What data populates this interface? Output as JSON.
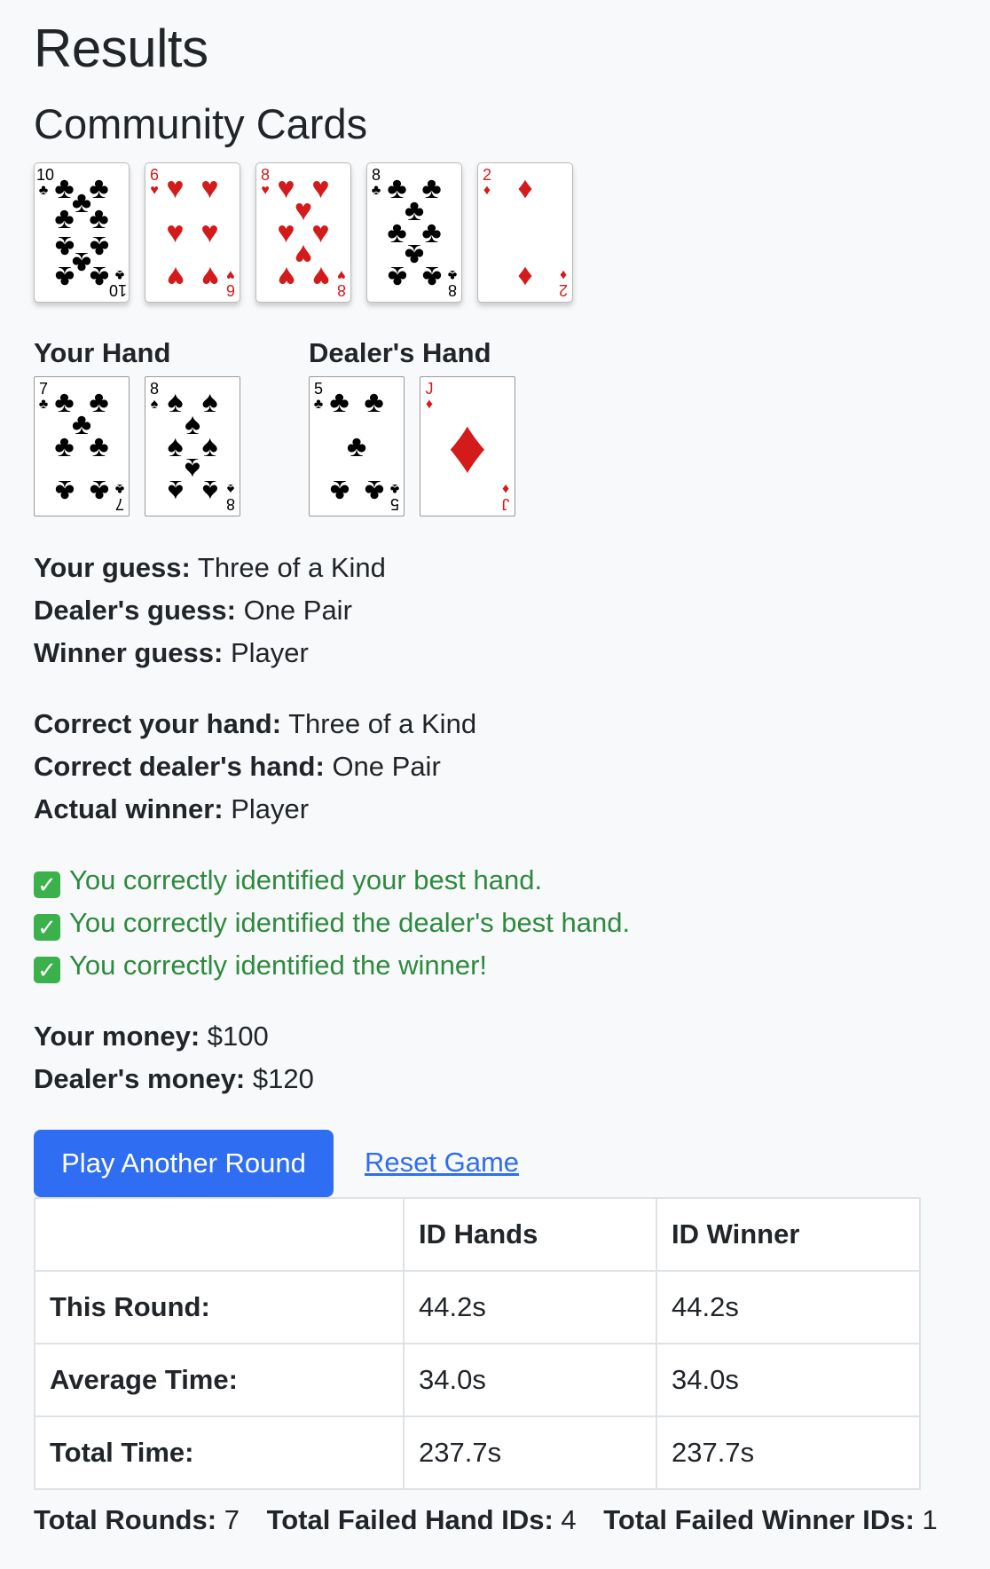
{
  "page_title": "Results",
  "community": {
    "heading": "Community Cards",
    "cards": [
      {
        "rank": "10",
        "suit": "♣",
        "color": "black"
      },
      {
        "rank": "6",
        "suit": "♥",
        "color": "red"
      },
      {
        "rank": "8",
        "suit": "♥",
        "color": "red"
      },
      {
        "rank": "8",
        "suit": "♣",
        "color": "black"
      },
      {
        "rank": "2",
        "suit": "♦",
        "color": "red"
      }
    ]
  },
  "your_hand": {
    "label": "Your Hand",
    "cards": [
      {
        "rank": "7",
        "suit": "♣",
        "color": "black"
      },
      {
        "rank": "8",
        "suit": "♠",
        "color": "black"
      }
    ]
  },
  "dealer_hand": {
    "label": "Dealer's Hand",
    "cards": [
      {
        "rank": "5",
        "suit": "♣",
        "color": "black"
      },
      {
        "rank": "J",
        "suit": "♦",
        "color": "red"
      }
    ]
  },
  "guesses": {
    "your_label": "Your guess:",
    "your_value": "Three of a Kind",
    "dealer_label": "Dealer's guess:",
    "dealer_value": "One Pair",
    "winner_label": "Winner guess:",
    "winner_value": "Player"
  },
  "correct": {
    "your_label": "Correct your hand:",
    "your_value": "Three of a Kind",
    "dealer_label": "Correct dealer's hand:",
    "dealer_value": "One Pair",
    "winner_label": "Actual winner:",
    "winner_value": "Player"
  },
  "feedback": {
    "check_icon": "check-mark-icon",
    "line1": "You correctly identified your best hand.",
    "line2": "You correctly identified the dealer's best hand.",
    "line3": "You correctly identified the winner!"
  },
  "money": {
    "your_label": "Your money:",
    "your_value": "$100",
    "dealer_label": "Dealer's money:",
    "dealer_value": "$120"
  },
  "actions": {
    "play_label": "Play Another Round",
    "reset_label": "Reset Game"
  },
  "stats": {
    "headers": [
      "",
      "ID Hands",
      "ID Winner"
    ],
    "rows": [
      {
        "label": "This Round:",
        "hands": "44.2s",
        "winner": "44.2s"
      },
      {
        "label": "Average Time:",
        "hands": "34.0s",
        "winner": "34.0s"
      },
      {
        "label": "Total Time:",
        "hands": "237.7s",
        "winner": "237.7s"
      }
    ]
  },
  "totals": {
    "rounds_label": "Total Rounds:",
    "rounds_value": "7",
    "failed_hand_label": "Total Failed Hand IDs:",
    "failed_hand_value": "4",
    "failed_winner_label": "Total Failed Winner IDs:",
    "failed_winner_value": "1"
  },
  "colors": {
    "primary": "#2f6ef2",
    "success": "#2d8a3e",
    "card_red": "#d31b1b"
  }
}
